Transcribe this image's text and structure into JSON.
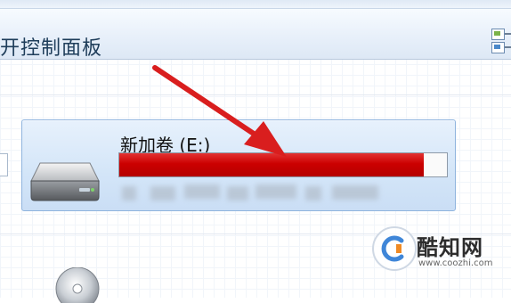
{
  "command_bar": {
    "text": "开控制面板"
  },
  "drive": {
    "label": "新加卷 (E:)",
    "used_fraction": 0.93,
    "fill_color": "#cc0000"
  },
  "watermark": {
    "name": "酷知网",
    "url": "www.coozhi.com"
  },
  "icons": {
    "drive": "hard-drive-icon",
    "disc": "cd-drive-icon",
    "view": "view-options-icon"
  },
  "colors": {
    "accent": "#cc0000",
    "tile": "#d3e5f8",
    "arrow": "#d91e1e"
  }
}
